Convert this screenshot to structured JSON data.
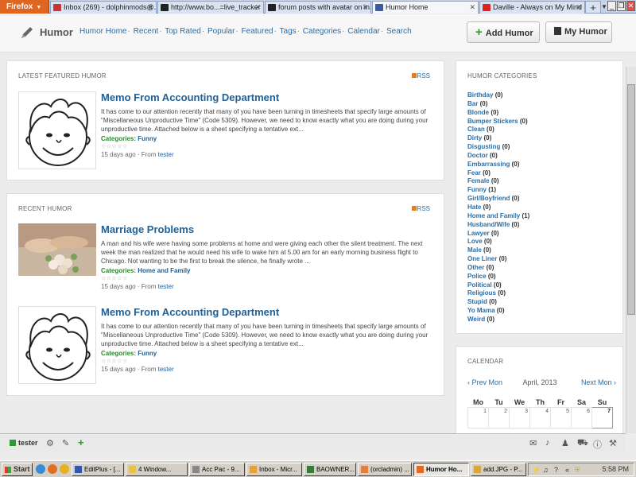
{
  "browser": {
    "menu_label": "Firefox",
    "tabs": [
      {
        "label": "Inbox (269) - dolphinmods@...",
        "favicon_color": "#cc3333"
      },
      {
        "label": "http://www.bo...=live_tracker",
        "favicon_color": "#222222"
      },
      {
        "label": "forum posts with avatar on in...",
        "favicon_color": "#222222"
      },
      {
        "label": "Humor Home",
        "favicon_color": "#3a5ba0"
      },
      {
        "label": "Daville - Always on My Mind -...",
        "favicon_color": "#dd2222"
      }
    ]
  },
  "header": {
    "brand": "Humor",
    "nav": [
      "Humor Home",
      "Recent",
      "Top Rated",
      "Popular",
      "Featured",
      "Tags",
      "Categories",
      "Calendar",
      "Search"
    ],
    "add_button": "Add Humor",
    "my_button": "My Humor"
  },
  "featured": {
    "title": "LATEST FEATURED HUMOR",
    "rss": "RSS",
    "entry": {
      "title": "Memo From Accounting Department",
      "excerpt": "It has come to our attention recently that many of you have been turning in timesheets that specify large amounts of \"Miscellaneous Unproductive Time\" (Code 5309). However, we need to know exactly what you are doing during your unproductive time. Attached below is a sheet specifying a tentative ext...",
      "cat_label": "Categories:",
      "category": "Funny",
      "stars": "☆☆☆☆☆",
      "ago": "15 days ago",
      "from": "From",
      "author": "tester"
    }
  },
  "recent": {
    "title": "RECENT HUMOR",
    "rss": "RSS",
    "entries": [
      {
        "title": "Marriage Problems",
        "excerpt": "A man and his wife were having some problems at home and were giving each other the silent treatment. The next week the man realized that he would need his wife to wake him at 5.00 am for an early morning business flight to Chicago. Not wanting to be the first to break the silence, he finally wrote ...",
        "cat_label": "Categories:",
        "category": "Home and Family",
        "stars": "☆☆☆☆☆",
        "ago": "15 days ago",
        "from": "From",
        "author": "tester"
      },
      {
        "title": "Memo From Accounting Department",
        "excerpt": "It has come to our attention recently that many of you have been turning in timesheets that specify large amounts of \"Miscellaneous Unproductive Time\" (Code 5309). However, we need to know exactly what you are doing during your unproductive time. Attached below is a sheet specifying a tentative ext...",
        "cat_label": "Categories:",
        "category": "Funny",
        "stars": "☆☆☆☆☆",
        "ago": "15 days ago",
        "from": "From",
        "author": "tester"
      }
    ]
  },
  "categories": {
    "title": "HUMOR CATEGORIES",
    "items": [
      {
        "name": "Birthday",
        "count": "(0)"
      },
      {
        "name": "Bar",
        "count": "(0)"
      },
      {
        "name": "Blonde",
        "count": "(0)"
      },
      {
        "name": "Bumper Stickers",
        "count": "(0)"
      },
      {
        "name": "Clean",
        "count": "(0)"
      },
      {
        "name": "Dirty",
        "count": "(0)"
      },
      {
        "name": "Disgusting",
        "count": "(0)"
      },
      {
        "name": "Doctor",
        "count": "(0)"
      },
      {
        "name": "Embarrassing",
        "count": "(0)"
      },
      {
        "name": "Fear",
        "count": "(0)"
      },
      {
        "name": "Female",
        "count": "(0)"
      },
      {
        "name": "Funny",
        "count": "(1)"
      },
      {
        "name": "Girl/Boyfriend",
        "count": "(0)"
      },
      {
        "name": "Hate",
        "count": "(0)"
      },
      {
        "name": "Home and Family",
        "count": "(1)"
      },
      {
        "name": "Husband/Wife",
        "count": "(0)"
      },
      {
        "name": "Lawyer",
        "count": "(0)"
      },
      {
        "name": "Love",
        "count": "(0)"
      },
      {
        "name": "Male",
        "count": "(0)"
      },
      {
        "name": "One Liner",
        "count": "(0)"
      },
      {
        "name": "Other",
        "count": "(0)"
      },
      {
        "name": "Police",
        "count": "(0)"
      },
      {
        "name": "Political",
        "count": "(0)"
      },
      {
        "name": "Religious",
        "count": "(0)"
      },
      {
        "name": "Stupid",
        "count": "(0)"
      },
      {
        "name": "Yo Mama",
        "count": "(0)"
      },
      {
        "name": "Weird",
        "count": "(0)"
      }
    ]
  },
  "calendar": {
    "title": "CALENDAR",
    "prev": "‹ Prev Mon",
    "month": "April, 2013",
    "next": "Next Mon ›",
    "weekdays": [
      "Mo",
      "Tu",
      "We",
      "Th",
      "Fr",
      "Sa",
      "Su"
    ],
    "days": [
      "1",
      "2",
      "3",
      "4",
      "5",
      "6",
      "7"
    ]
  },
  "toolbar": {
    "user": "tester"
  },
  "taskbar": {
    "start": "Start",
    "tasks": [
      {
        "label": "EditPlus - [...",
        "icon_color": "#3355aa"
      },
      {
        "label": "4 Window...",
        "icon_color": "#e6c24a"
      },
      {
        "label": "Acc Pac - 9...",
        "icon_color": "#888888"
      },
      {
        "label": "Inbox - Micr...",
        "icon_color": "#e6a23a"
      },
      {
        "label": "BAOWNER...",
        "icon_color": "#3a7a3a"
      },
      {
        "label": "(orcladmin) ...",
        "icon_color": "#e08040"
      },
      {
        "label": "Humor Ho...",
        "icon_color": "#e06a20"
      },
      {
        "label": "add.JPG - P...",
        "icon_color": "#d9a640"
      }
    ],
    "clock": "5:58 PM"
  }
}
